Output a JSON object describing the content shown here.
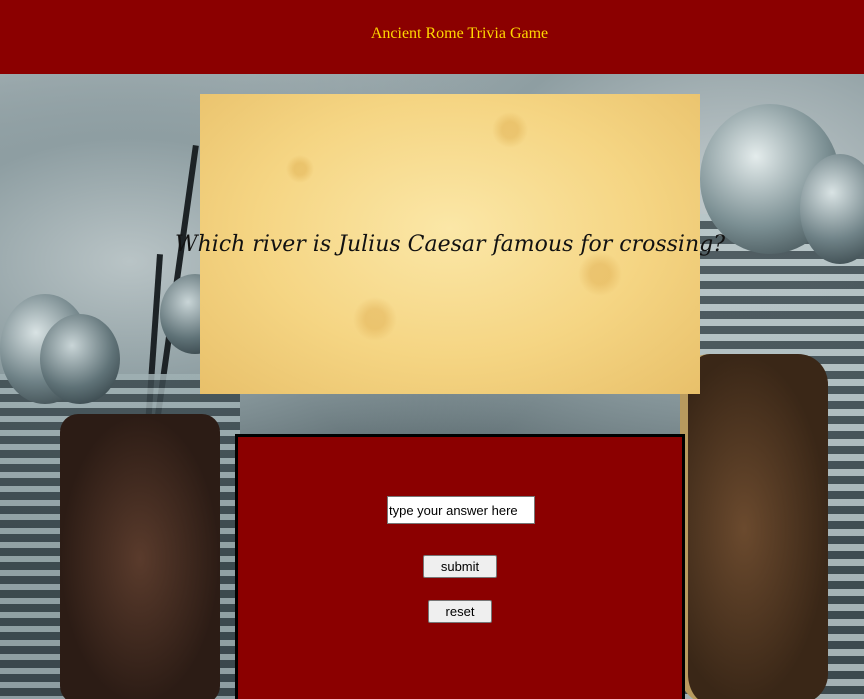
{
  "header": {
    "title": "Ancient Rome Trivia Game",
    "background_color": "#8b0000",
    "title_color": "#ffd700"
  },
  "question": {
    "text": "Which river is Julius Caesar famous for crossing?"
  },
  "answer_form": {
    "input_value": "",
    "input_placeholder": "type your answer here",
    "submit_label": "submit",
    "reset_label": "reset",
    "panel_color": "#8b0000"
  }
}
